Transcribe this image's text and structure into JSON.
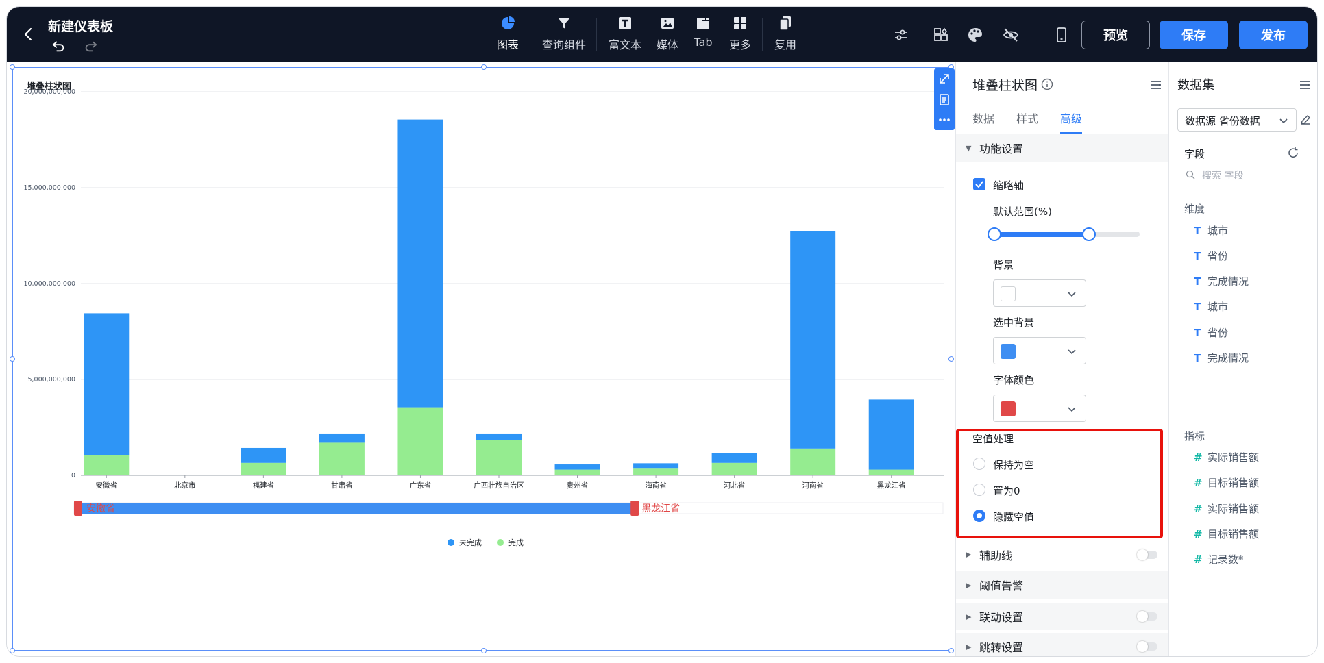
{
  "topbar": {
    "title": "新建仪表板",
    "tools": [
      {
        "label": "图表",
        "icon": "pie-chart-icon",
        "active": true
      },
      {
        "label": "查询组件",
        "icon": "filter-icon"
      },
      {
        "label": "富文本",
        "icon": "text-icon"
      },
      {
        "label": "媒体",
        "icon": "image-icon"
      },
      {
        "label": "Tab",
        "icon": "tab-icon"
      },
      {
        "label": "更多",
        "icon": "grid-icon"
      },
      {
        "label": "复用",
        "icon": "copy-icon"
      }
    ],
    "preview_label": "预览",
    "save_label": "保存",
    "publish_label": "发布",
    "accent_color": "#2e7cf6"
  },
  "chart_title": "堆叠柱状图",
  "chart_data": {
    "type": "bar",
    "stacked": true,
    "title": "堆叠柱状图",
    "xlabel": "",
    "ylabel": "",
    "ylim": [
      0,
      20000000000
    ],
    "yticks": [
      "0",
      "5,000,000,000",
      "10,000,000,000",
      "15,000,000,000",
      "20,000,000,000"
    ],
    "categories": [
      "安徽省",
      "北京市",
      "福建省",
      "甘肃省",
      "广东省",
      "广西壮族自治区",
      "贵州省",
      "海南省",
      "河北省",
      "河南省",
      "黑龙江省"
    ],
    "series": [
      {
        "name": "完成",
        "color": "#95ec90",
        "values": [
          1050000000,
          0,
          650000000,
          1700000000,
          3550000000,
          1850000000,
          300000000,
          350000000,
          650000000,
          1400000000,
          300000000
        ]
      },
      {
        "name": "未完成",
        "color": "#2e95f6",
        "values": [
          7400000000,
          0,
          780000000,
          480000000,
          15000000000,
          330000000,
          270000000,
          280000000,
          520000000,
          11350000000,
          3650000000
        ]
      }
    ],
    "legend": [
      "未完成",
      "完成"
    ],
    "legend_position": "bottom-center",
    "grid": true,
    "zoom": {
      "start_label": "安徽省",
      "end_label": "黑龙江省",
      "start": 0,
      "end": 0.65
    }
  },
  "panel": {
    "title": "堆叠柱状图",
    "tabs": [
      {
        "label": "数据",
        "active": false
      },
      {
        "label": "样式",
        "active": false
      },
      {
        "label": "高级",
        "active": true
      }
    ],
    "function_section": "功能设置",
    "thumbnail_axis": "缩略轴",
    "default_range_label": "默认范围(%)",
    "range_start": 0,
    "range_end": 0.65,
    "background_label": "背景",
    "background_color": "#ffffff",
    "selected_bg_label": "选中背景",
    "selected_bg_color": "#3e8ef2",
    "font_color_label": "字体颜色",
    "font_color": "#e04848",
    "null_section": "空值处理",
    "null_options": [
      {
        "label": "保持为空",
        "checked": false
      },
      {
        "label": "置为0",
        "checked": false
      },
      {
        "label": "隐藏空值",
        "checked": true
      }
    ],
    "collapsed_sections": [
      {
        "label": "辅助线",
        "toggle": true
      },
      {
        "label": "阈值告警",
        "toggle": false
      },
      {
        "label": "联动设置",
        "toggle": true
      },
      {
        "label": "跳转设置",
        "toggle": true
      }
    ]
  },
  "dataset": {
    "title": "数据集",
    "source_label": "数据源 省份数据",
    "fields_label": "字段",
    "search_placeholder": "搜索 字段",
    "dimensions_label": "维度",
    "dimensions": [
      "城市",
      "省份",
      "完成情况",
      "城市",
      "省份",
      "完成情况"
    ],
    "measures_label": "指标",
    "measures": [
      "实际销售额",
      "目标销售额",
      "实际销售额",
      "目标销售额",
      "记录数*"
    ]
  }
}
